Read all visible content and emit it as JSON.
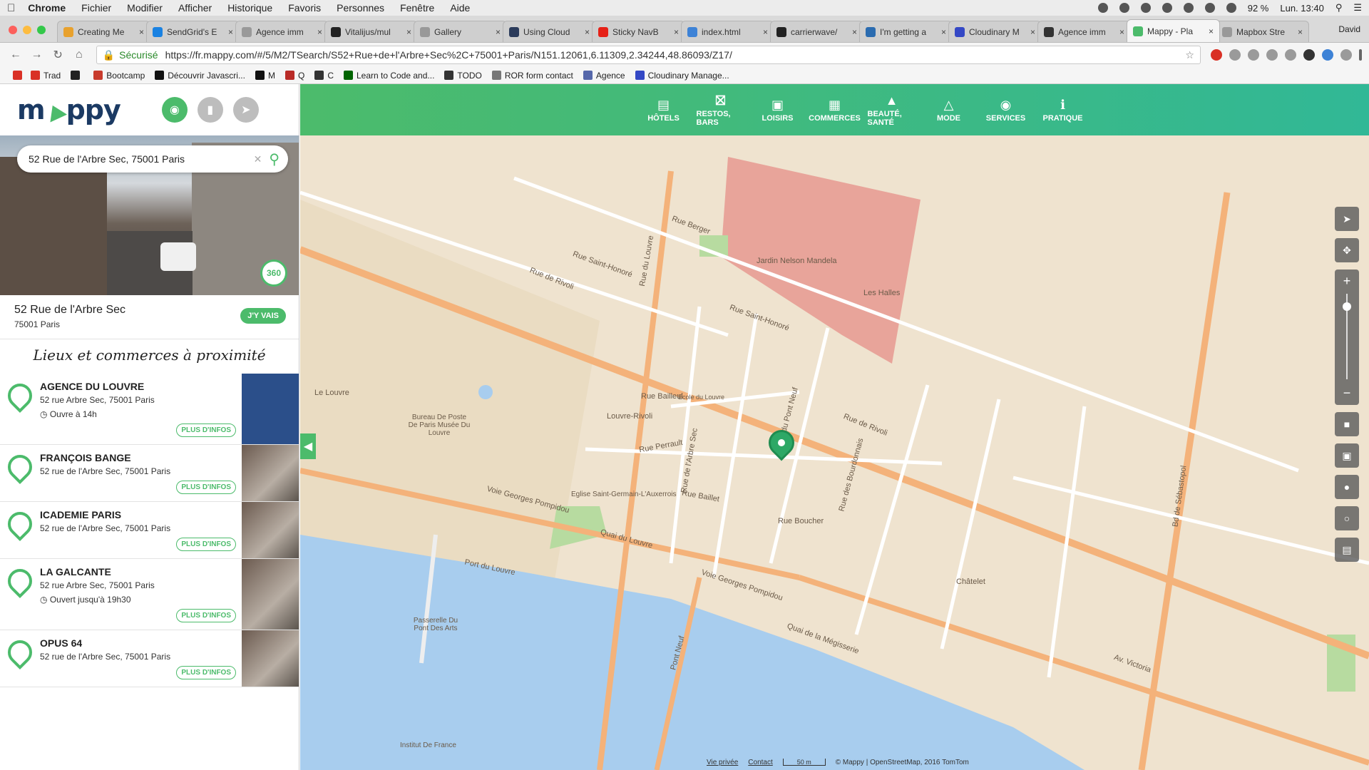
{
  "menubar": {
    "app": "Chrome",
    "items": [
      "Fichier",
      "Modifier",
      "Afficher",
      "Historique",
      "Favoris",
      "Personnes",
      "Fenêtre",
      "Aide"
    ],
    "battery": "92 %",
    "clock": "Lun. 13:40"
  },
  "tabs": [
    {
      "title": "Creating Me",
      "color": "#e8a12d"
    },
    {
      "title": "SendGrid's E",
      "color": "#1a82e2"
    },
    {
      "title": "Agence imm",
      "color": "#999999"
    },
    {
      "title": "Vitalijus/mul",
      "color": "#222222"
    },
    {
      "title": "Gallery",
      "color": "#999999"
    },
    {
      "title": "Using Cloud",
      "color": "#2b3b5b"
    },
    {
      "title": "Sticky NavB",
      "color": "#e62117"
    },
    {
      "title": "index.html",
      "color": "#3d82d6"
    },
    {
      "title": "carrierwave/",
      "color": "#222222"
    },
    {
      "title": "I'm getting a",
      "color": "#2b6cb0"
    },
    {
      "title": "Cloudinary M",
      "color": "#3448c5"
    },
    {
      "title": "Agence imm",
      "color": "#333333"
    },
    {
      "title": "Mappy - Pla",
      "color": "#4cbb6b",
      "active": true
    },
    {
      "title": "Mapbox Stre",
      "color": "#999999"
    }
  ],
  "profile": "David",
  "toolbar": {
    "secure_label": "Sécurisé",
    "url": "https://fr.mappy.com/#/5/M2/TSearch/S52+Rue+de+l'Arbre+Sec%2C+75001+Paris/N151.12061,6.11309,2.34244,48.86093/Z17/"
  },
  "bookmarks": [
    {
      "label": "Trad",
      "color": "#d93025"
    },
    {
      "label": "",
      "color": "#222222"
    },
    {
      "label": "Bootcamp",
      "color": "#c83b2c"
    },
    {
      "label": "Découvrir Javascri...",
      "color": "#111111"
    },
    {
      "label": "M",
      "color": "#111111"
    },
    {
      "label": "Q",
      "color": "#b92b27"
    },
    {
      "label": "C",
      "color": "#333333"
    },
    {
      "label": "Learn to Code and...",
      "color": "#006400"
    },
    {
      "label": "TODO",
      "color": "#333333"
    },
    {
      "label": "ROR form contact",
      "color": "#777777"
    },
    {
      "label": "Agence",
      "color": "#5567aa"
    },
    {
      "label": "Cloudinary Manage...",
      "color": "#3448c5"
    }
  ],
  "brand": {
    "logo_text_left": "m",
    "logo_text_right": "ppy"
  },
  "search": {
    "value": "52 Rue de l'Arbre Sec, 75001 Paris"
  },
  "photo_badge": "360",
  "address": {
    "street": "52 Rue de l'Arbre Sec",
    "city": "75001 Paris",
    "go_label": "J'Y VAIS"
  },
  "nearby_title": "Lieux et commerces à proximité",
  "pois": [
    {
      "name": "AGENCE DU LOUVRE",
      "address": "52 rue Arbre Sec, 75001 Paris",
      "hours": "Ouvre à 14h",
      "more": "PLUS D'INFOS"
    },
    {
      "name": "FRANÇOIS BANGE",
      "address": "52 rue de l'Arbre Sec, 75001 Paris",
      "hours": "",
      "more": "PLUS D'INFOS"
    },
    {
      "name": "ICADEMIE PARIS",
      "address": "52 rue de l'Arbre Sec, 75001 Paris",
      "hours": "",
      "more": "PLUS D'INFOS"
    },
    {
      "name": "LA GALCANTE",
      "address": "52 rue Arbre Sec, 75001 Paris",
      "hours": "Ouvert jusqu'à 19h30",
      "more": "PLUS D'INFOS"
    },
    {
      "name": "OPUS 64",
      "address": "52 rue de l'Arbre Sec, 75001 Paris",
      "hours": "",
      "more": "PLUS D'INFOS"
    }
  ],
  "categories": [
    "HÔTELS",
    "RESTOS, BARS",
    "LOISIRS",
    "COMMERCES",
    "BEAUTÉ, SANTÉ",
    "MODE",
    "SERVICES",
    "PRATIQUE"
  ],
  "map_labels": {
    "rue_rivoli": "Rue de Rivoli",
    "rue_saint_honore": "Rue Saint-Honoré",
    "rue_louvre": "Rue du Louvre",
    "quai_louvre": "Quai du Louvre",
    "voie_pompidou": "Voie Georges Pompidou",
    "port_louvre": "Port du Louvre",
    "rue_berger": "Rue Berger",
    "rue_arbre_sec": "Rue de l'Arbre Sec",
    "rue_bailleul": "Rue Bailleul",
    "rue_baillet": "Rue Baillet",
    "rue_boucher": "Rue Boucher",
    "rue_perrault": "Rue Perrault",
    "pont_neuf": "Pont Neuf",
    "av_victoria": "Av. Victoria",
    "bd_sebastopol": "Bd de Sébastopol",
    "le_louvre": "Le Louvre",
    "les_halles": "Les Halles",
    "jardin_nelson": "Jardin Nelson Mandela",
    "chatelet": "Châtelet",
    "bureau_poste": "Bureau De Poste De Paris Musée Du Louvre",
    "louvre_rivoli": "Louvre-Rivoli",
    "ecole": "Ecole du Louvre",
    "eglise": "Eglise Saint-Germain-L'Auxerrois",
    "passerelle": "Passerelle Du Pont Des Arts",
    "quai_megisserie": "Quai de la Mégisserie",
    "rue_pont_neuf": "Rue du Pont Neuf",
    "rue_bourdonnais": "Rue des Bourdonnais",
    "institut": "Institut De France"
  },
  "map_footer": {
    "privacy": "Vie privée",
    "contact": "Contact",
    "scale": "50 m",
    "credits": "© Mappy | OpenStreetMap, 2016 TomTom"
  }
}
